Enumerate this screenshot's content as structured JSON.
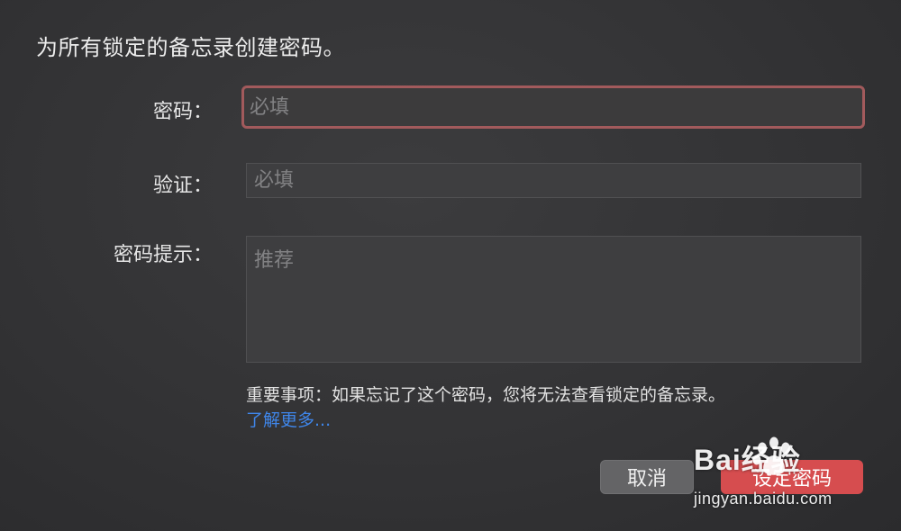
{
  "dialog": {
    "heading": "为所有锁定的备忘录创建密码。",
    "password": {
      "label": "密码：",
      "placeholder": "必填"
    },
    "verify": {
      "label": "验证：",
      "placeholder": "必填"
    },
    "hint": {
      "label": "密码提示：",
      "placeholder": "推荐"
    },
    "note": "重要事项：如果忘记了这个密码，您将无法查看锁定的备忘录。",
    "learn_more": "了解更多...",
    "buttons": {
      "cancel": "取消",
      "set": "设定密码"
    }
  },
  "watermark": {
    "logo_text": "Bai经验",
    "url": "jingyan.baidu.com"
  },
  "colors": {
    "accent": "#d64d4f",
    "link": "#3f86ea",
    "focus_ring": "#a25a5c"
  }
}
